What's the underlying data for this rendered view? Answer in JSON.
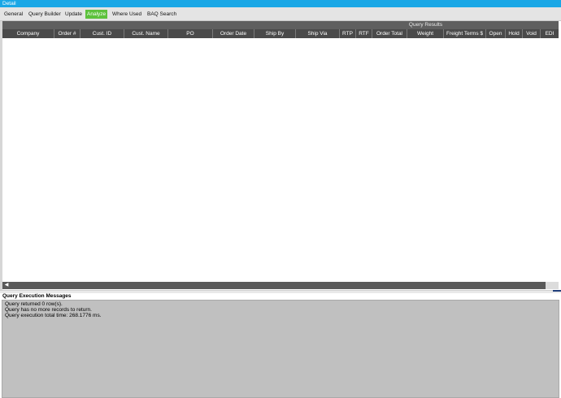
{
  "window": {
    "title": "Detail"
  },
  "tabs": [
    {
      "label": "General"
    },
    {
      "label": "Query Builder"
    },
    {
      "label": "Update"
    },
    {
      "label": "Analyze",
      "active": true
    },
    {
      "label": "Where Used"
    },
    {
      "label": "BAQ Search"
    }
  ],
  "grid": {
    "header_title": "Query Results",
    "columns": [
      "Company",
      "Order #",
      "Cust. ID",
      "Cust. Name",
      "PO",
      "Order Date",
      "Ship By",
      "Ship Via",
      "RTP",
      "RTF",
      "Order Total",
      "Weight",
      "Freight Terms $",
      "Open",
      "Hold",
      "Void",
      "EDI"
    ],
    "rows": []
  },
  "messages": {
    "title": "Query Execution Messages",
    "lines": [
      "Query returned 0 row(s).",
      "Query has no more records to return.",
      "Query execution total time: 268.1776 ms."
    ]
  },
  "colors": {
    "titlebar": "#1aa7e6",
    "active_tab": "#5cc13c",
    "header": "#4a4a4a"
  }
}
